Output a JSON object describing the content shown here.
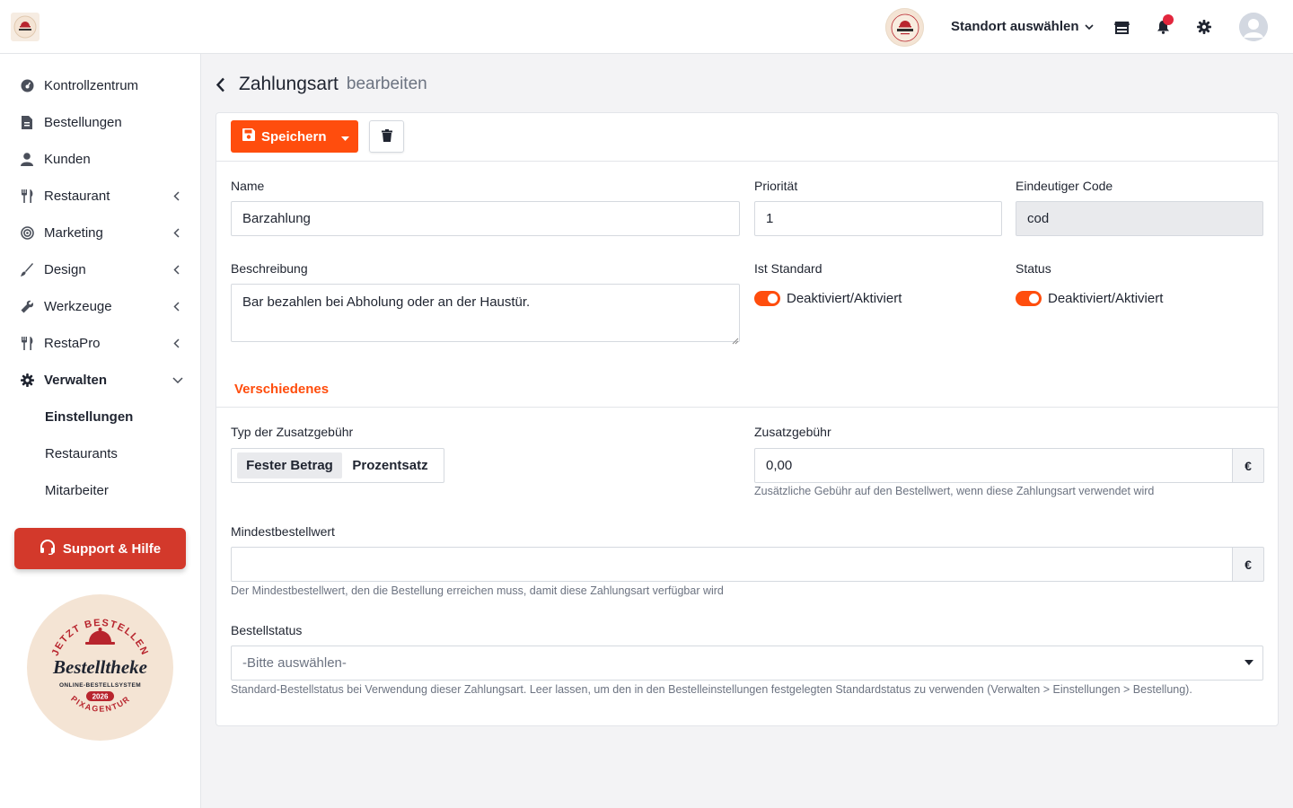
{
  "topbar": {
    "location_label": "Standort auswählen",
    "colors": {
      "notification_dot": "#e2263d"
    }
  },
  "sidebar": {
    "items": [
      {
        "label": "Kontrollzentrum",
        "icon": "dashboard-icon"
      },
      {
        "label": "Bestellungen",
        "icon": "receipt-icon"
      },
      {
        "label": "Kunden",
        "icon": "user-icon"
      },
      {
        "label": "Restaurant",
        "icon": "utensils-icon",
        "expandable": true
      },
      {
        "label": "Marketing",
        "icon": "target-icon",
        "expandable": true
      },
      {
        "label": "Design",
        "icon": "brush-icon",
        "expandable": true
      },
      {
        "label": "Werkzeuge",
        "icon": "wrench-icon",
        "expandable": true
      },
      {
        "label": "RestaPro",
        "icon": "utensils-icon",
        "expandable": true
      },
      {
        "label": "Verwalten",
        "icon": "gear-icon",
        "expandable": true,
        "expanded": true
      }
    ],
    "sub_items": [
      {
        "label": "Einstellungen",
        "active": true
      },
      {
        "label": "Restaurants"
      },
      {
        "label": "Mitarbeiter"
      }
    ],
    "support_label": "Support & Hilfe",
    "seal": {
      "top_text": "JETZT BESTELLEN",
      "brand": "Bestelltheke",
      "tagline": "ONLINE-BESTELLSYSTEM",
      "year": "2026",
      "bottom_text": "PIXAGENTUR"
    }
  },
  "page": {
    "title": "Zahlungsart",
    "subtitle": "bearbeiten"
  },
  "toolbar": {
    "save_label": "Speichern"
  },
  "form": {
    "name": {
      "label": "Name",
      "value": "Barzahlung"
    },
    "priority": {
      "label": "Priorität",
      "value": "1"
    },
    "code": {
      "label": "Eindeutiger Code",
      "value": "cod"
    },
    "description": {
      "label": "Beschreibung",
      "value": "Bar bezahlen bei Abholung oder an der Haustür."
    },
    "is_default": {
      "label": "Ist Standard",
      "toggle_label": "Deaktiviert/Aktiviert",
      "on": true
    },
    "status": {
      "label": "Status",
      "toggle_label": "Deaktiviert/Aktiviert",
      "on": true
    }
  },
  "misc": {
    "section_title": "Verschiedenes",
    "fee_type": {
      "label": "Typ der Zusatzgebühr",
      "options": [
        "Fester Betrag",
        "Prozentsatz"
      ],
      "selected": "Fester Betrag"
    },
    "fee": {
      "label": "Zusatzgebühr",
      "value": "0,00",
      "addon": "€",
      "help": "Zusätzliche Gebühr auf den Bestellwert, wenn diese Zahlungsart verwendet wird"
    },
    "min_order": {
      "label": "Mindestbestellwert",
      "value": "",
      "addon": "€",
      "help": "Der Mindestbestellwert, den die Bestellung erreichen muss, damit diese Zahlungsart verfügbar wird"
    },
    "order_status": {
      "label": "Bestellstatus",
      "placeholder": "-Bitte auswählen-",
      "help": "Standard-Bestellstatus bei Verwendung dieser Zahlungsart. Leer lassen, um den in den Bestelleinstellungen festgelegten Standardstatus zu verwenden (Verwalten > Einstellungen > Bestellung)."
    }
  },
  "colors": {
    "accent": "#ff4d0d",
    "support": "#d3392b",
    "seal_red": "#b8252e"
  }
}
